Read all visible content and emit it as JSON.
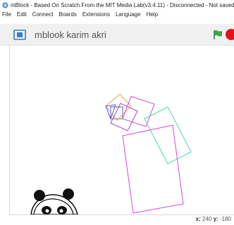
{
  "window": {
    "title": "mBlock - Based On Scratch From the MIT Media Lab(v3.4.11) - Disconnected - Not saved"
  },
  "menu": {
    "items": [
      {
        "label": "File"
      },
      {
        "label": "Edit"
      },
      {
        "label": "Connect"
      },
      {
        "label": "Boards"
      },
      {
        "label": "Extensions"
      },
      {
        "label": "Language"
      },
      {
        "label": "Help"
      }
    ]
  },
  "stage_header": {
    "project_name": "mblook karim akri"
  },
  "stage_footer": {
    "x_label": "x:",
    "x_value": "240",
    "y_label": "y:",
    "y_value": "-180"
  },
  "colors": {
    "small_square": "#e8a64a",
    "blue_square": "#5a5ad8",
    "magenta_square": "#d646d6",
    "green_square": "#46d8a8",
    "stop_button": "#e4101b",
    "flag": "#2e8b3c"
  }
}
